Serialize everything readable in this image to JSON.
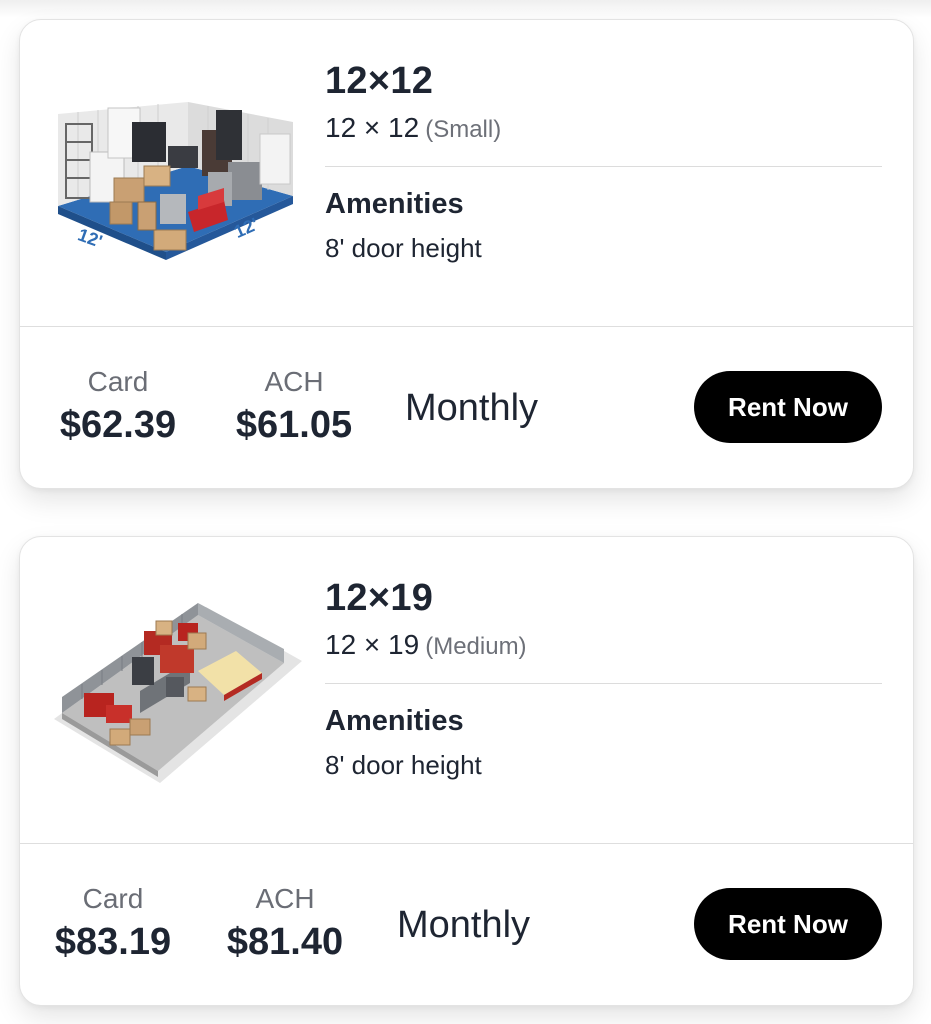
{
  "units": [
    {
      "title": "12×12",
      "dimensions": "12 × 12",
      "size_class": "(Small)",
      "amenities_heading": "Amenities",
      "amenities": [
        "8' door height"
      ],
      "image_dims_left": "12'",
      "image_dims_right": "12'",
      "card_price_label": "Card",
      "card_price": "$62.39",
      "ach_price_label": "ACH",
      "ach_price": "$61.05",
      "billing_period": "Monthly",
      "rent_label": "Rent Now"
    },
    {
      "title": "12×19",
      "dimensions": "12 × 19",
      "size_class": "(Medium)",
      "amenities_heading": "Amenities",
      "amenities": [
        "8' door height"
      ],
      "card_price_label": "Card",
      "card_price": "$83.19",
      "ach_price_label": "ACH",
      "ach_price": "$81.40",
      "billing_period": "Monthly",
      "rent_label": "Rent Now"
    }
  ],
  "colors": {
    "text_primary": "#1e2532",
    "text_secondary": "#6a6d75",
    "button_bg": "#000000",
    "button_text": "#ffffff",
    "floor_blue": "#2f6db5"
  }
}
